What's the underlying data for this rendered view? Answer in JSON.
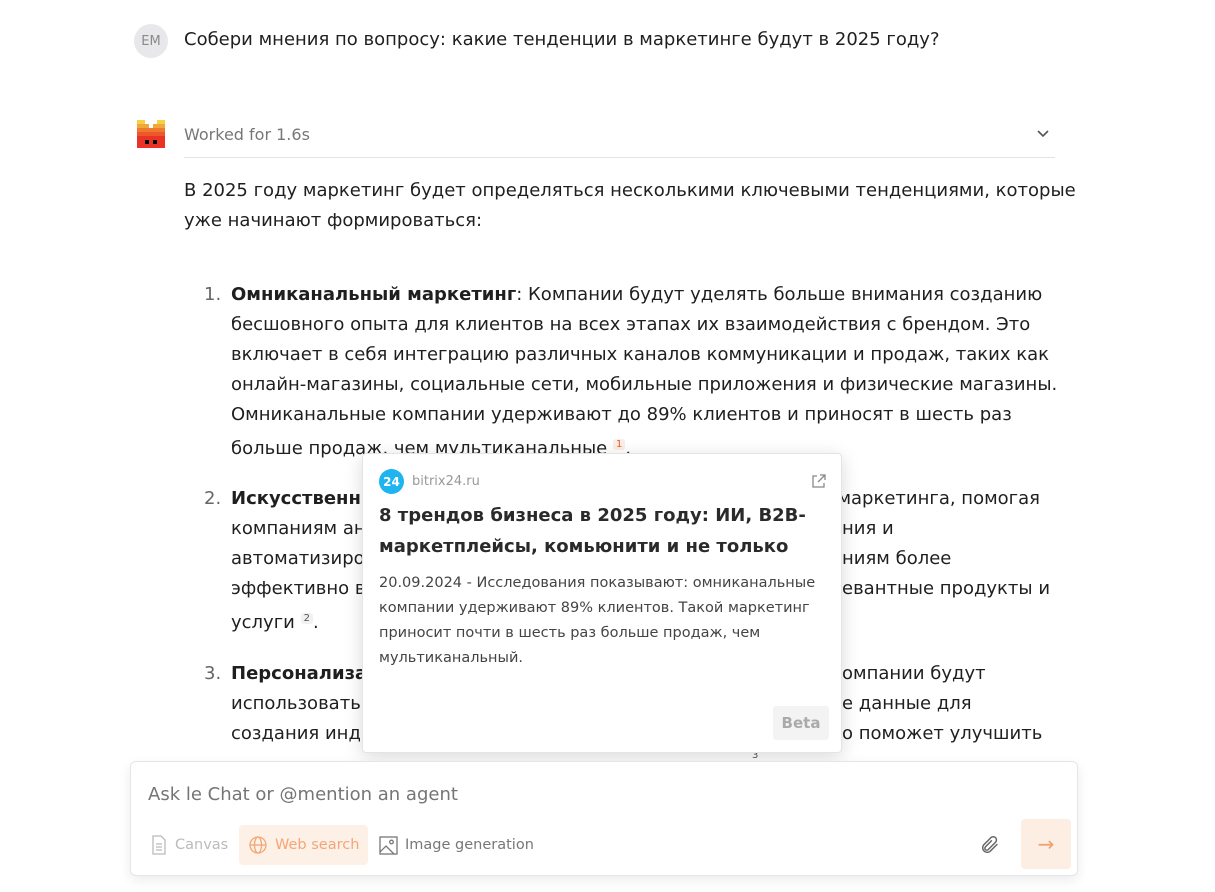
{
  "user": {
    "initials": "EM",
    "question": "Собери мнения по вопросу: какие тенденции в маркетинге будут в 2025 году?"
  },
  "assistant": {
    "status": "Worked for 1.6s",
    "intro": [
      "В 2025 году маркетинг будет определяться несколькими ключевыми тенденциями, которые",
      "уже начинают формироваться:"
    ],
    "items": [
      {
        "num": "1.",
        "title": "Омниканальный маркетинг",
        "lines": [
          ": Компании будут уделять больше внимания созданию",
          "бесшовного опыта для клиентов на всех этапах их взаимодействия с брендом. Это",
          "включает в себя интеграцию различных каналов коммуникации и продаж, таких как",
          "онлайн-магазины, социальные сети, мобильные приложения и физические магазины.",
          "Омниканальные компании удерживают до 89% клиентов и приносят в шесть раз",
          "больше продаж, чем мультиканальные"
        ],
        "cite": "1"
      },
      {
        "num": "2.",
        "title": "Искусственны",
        "left": [
          "компаниям ан",
          "автоматизиро",
          "эффективно вз",
          "услуги"
        ],
        "right": [
          "маркетинга, помогая",
          "ния и",
          "ниям более",
          "евантные продукты и"
        ],
        "cite": "2"
      },
      {
        "num": "3.",
        "title": "Персонализац",
        "left": [
          "использовать",
          "создания инди"
        ],
        "right": [
          "омпании будут",
          "е данные для",
          "о поможет улучшить"
        ],
        "cite": "3"
      }
    ]
  },
  "popover": {
    "favicon": "24",
    "domain": "bitrix24.ru",
    "title": "8 трендов бизнеса в 2025 году: ИИ, B2B-маркетплейсы, комьюнити и не только",
    "snippet": "20.09.2024 - Исследования показывают: омниканальные компании удерживают 89% клиентов. Такой маркетинг приносит почти в шесть раз больше продаж, чем мультиканальный.",
    "badge": "Beta"
  },
  "composer": {
    "placeholder": "Ask le Chat or @mention an agent",
    "tools": [
      {
        "label": "Canvas",
        "icon": "document-icon",
        "active": false
      },
      {
        "label": "Web search",
        "icon": "globe-icon",
        "active": true
      },
      {
        "label": "Image generation",
        "icon": "image-icon",
        "active": false
      }
    ],
    "accent": "#f08a4b"
  }
}
